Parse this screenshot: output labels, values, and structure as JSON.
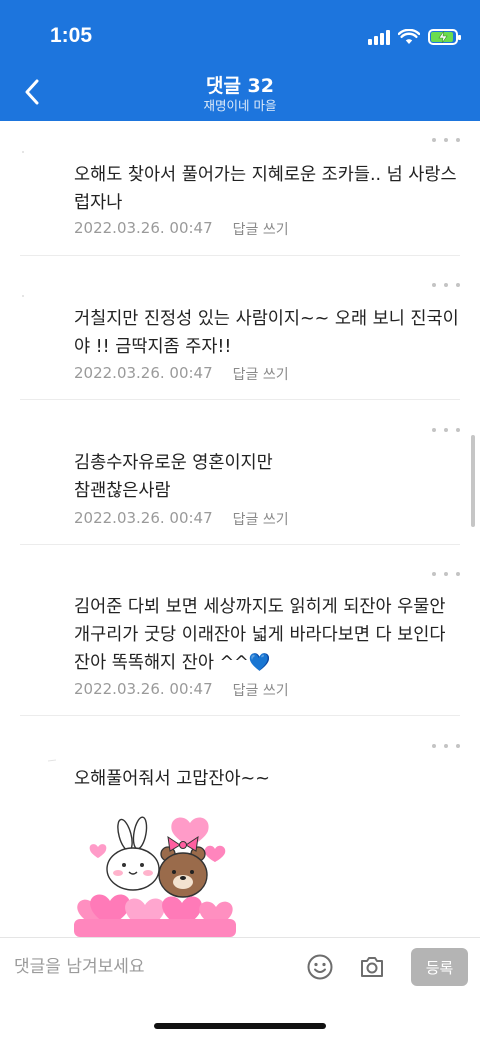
{
  "status_bar": {
    "time": "1:05"
  },
  "nav": {
    "title": "댓글 32",
    "subtitle": "재명이네 마을"
  },
  "comments": [
    {
      "text": "오해도 찾아서 풀어가는 지혜로운 조카들.. 넘 사랑스럽자나",
      "date": "2022.03.26. 00:47",
      "reply_label": "답글 쓰기"
    },
    {
      "text": "거칠지만 진정성 있는 사람이지~~ 오래 보니 진국이야 !! 금딱지좀 주자!!",
      "date": "2022.03.26. 00:47",
      "reply_label": "답글 쓰기"
    },
    {
      "text": "김총수자유로운 영혼이지만\n참괜찮은사람",
      "date": "2022.03.26. 00:47",
      "reply_label": "답글 쓰기"
    },
    {
      "text": "김어준  다뵈 보면 세상까지도 읽히게 되잔아 우물안 개구리가 굿당 이래잔아 넓게 바라다보면 다 보인다잔아 똑똑해지 잔아 ^^💙",
      "date": "2022.03.26. 00:47",
      "reply_label": "답글 쓰기"
    },
    {
      "text": "오해풀어줘서 고맙잔아~~",
      "date": "",
      "reply_label": ""
    }
  ],
  "input": {
    "placeholder": "댓글을 남겨보세요",
    "submit_label": "등록"
  },
  "colors": {
    "header_bg": "#1d75dd",
    "battery_fill": "#6bdc4f",
    "submit_bg": "#b4b4b4",
    "heart_pink": "#ff7ab8"
  },
  "icons": {
    "back": "chevron-left-icon",
    "more": "more-dots-icon",
    "emoji": "smiley-icon",
    "camera": "camera-icon"
  }
}
